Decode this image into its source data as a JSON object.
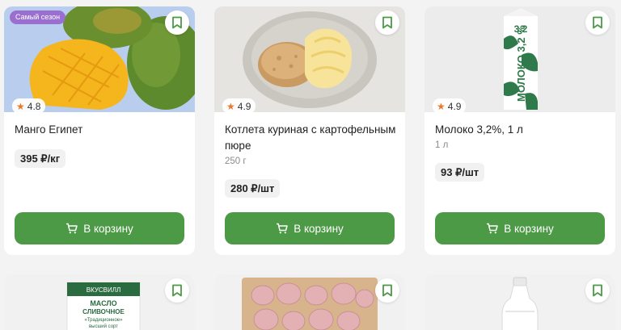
{
  "colors": {
    "accent_green": "#4c9a45",
    "badge_purple": "#9b6fcf",
    "star_orange": "#e8792b",
    "page_bg": "#f3f3f3"
  },
  "icons": {
    "bookmark": "bookmark-icon",
    "star": "star-icon",
    "cart": "cart-icon"
  },
  "products": [
    {
      "badge": "Самый сезон",
      "rating": "4.8",
      "title": "Манго Египет",
      "weight": "",
      "price": "395 ₽/кг",
      "button": "В корзину"
    },
    {
      "badge": "",
      "rating": "4.9",
      "title": "Котлета куриная с картофельным пюре",
      "weight": "250 г",
      "price": "280 ₽/шт",
      "button": "В корзину"
    },
    {
      "badge": "",
      "rating": "4.9",
      "title": "Молоко 3,2%, 1 л",
      "weight": "1 л",
      "price": "93 ₽/шт",
      "button": "В корзину"
    }
  ],
  "packaging": {
    "milk_carton_text": "МОЛОКО 3,2 %",
    "milk_carton_fat": "3,2",
    "butter_brand": "ВКУСВИЛЛ",
    "butter_line1": "МАСЛО",
    "butter_line2": "СЛИВОЧНОЕ",
    "butter_line3": "«Традиционное»",
    "butter_line4": "высший сорт"
  }
}
